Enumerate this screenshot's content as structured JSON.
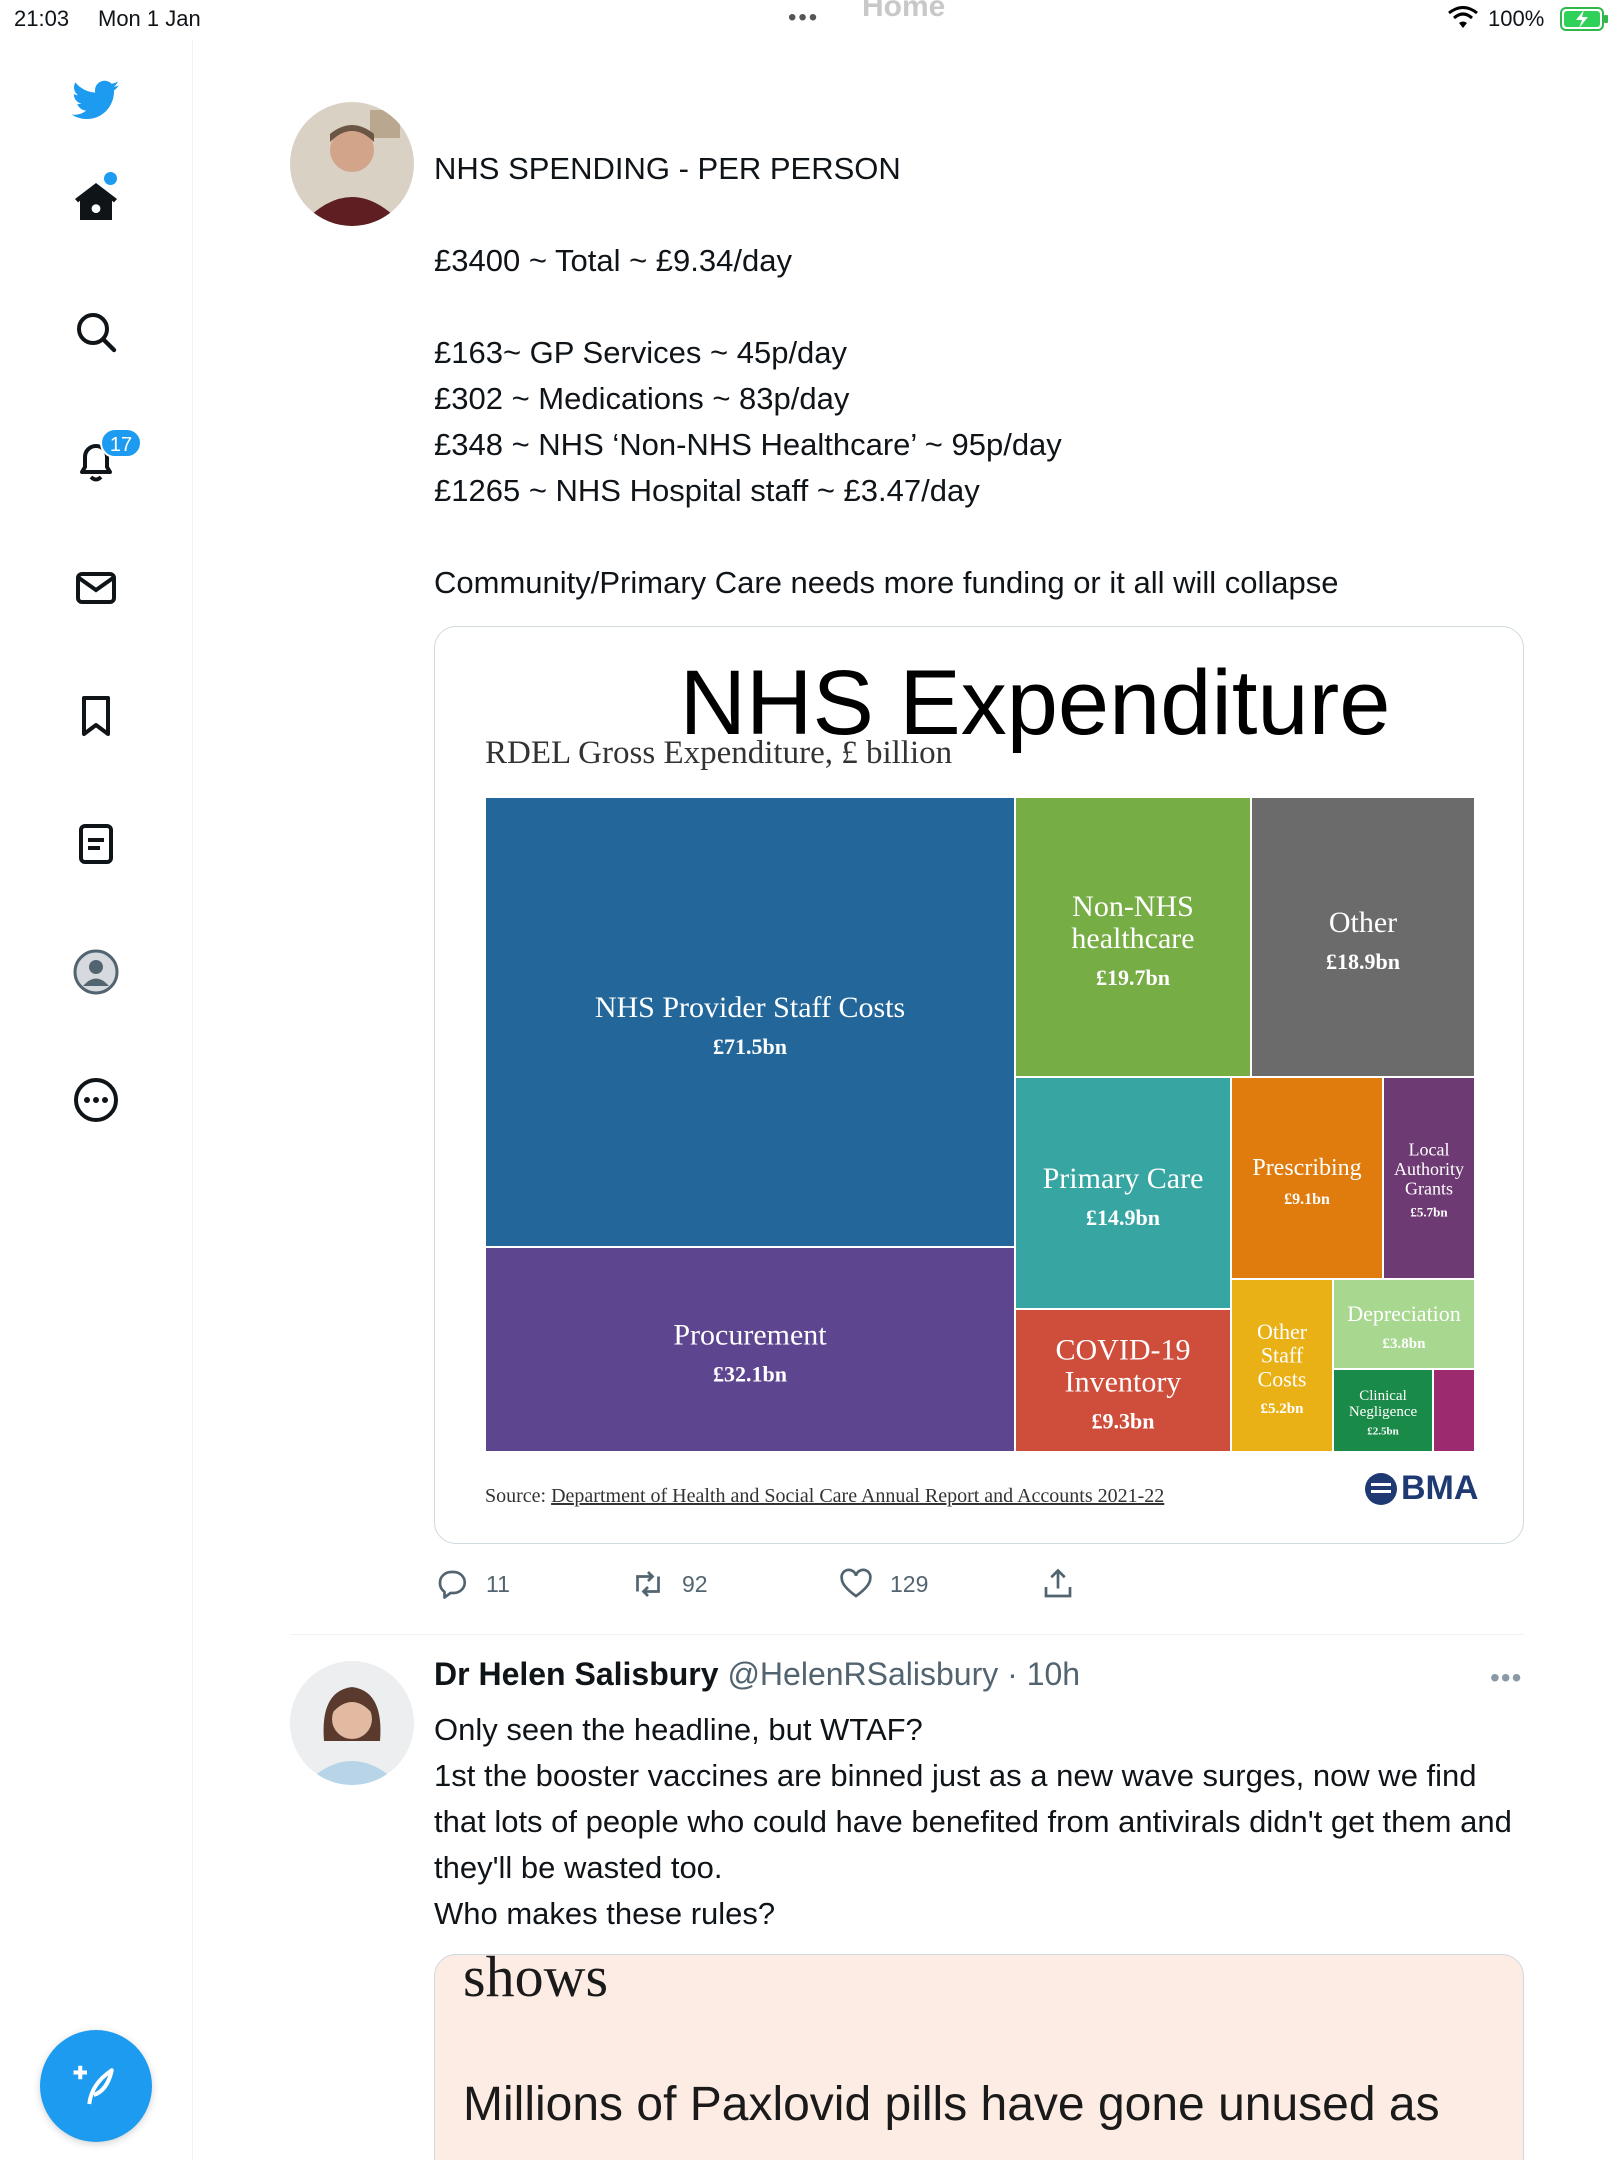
{
  "status_bar": {
    "time": "21:03",
    "date": "Mon 1 Jan",
    "home_label": "Home",
    "battery_percent": "100%"
  },
  "sidebar": {
    "notifications_badge": "17",
    "accent_color": "#1d9bf0",
    "icons": [
      "twitter-bird-icon",
      "home-icon",
      "search-icon",
      "bell-icon",
      "mail-icon",
      "bookmark-icon",
      "lists-icon",
      "profile-icon",
      "more-icon",
      "compose-icon"
    ]
  },
  "tweet1": {
    "text": "NHS SPENDING - PER PERSON\n\n£3400 ~ Total ~ £9.34/day\n\n£163~ GP Services ~ 45p/day\n£302 ~ Medications ~ 83p/day\n£348 ~ NHS ‘Non-NHS Healthcare’ ~ 95p/day\n£1265 ~ NHS Hospital staff ~ £3.47/day\n\nCommunity/Primary Care needs more funding or it all will collapse",
    "replies": "11",
    "retweets": "92",
    "likes": "129"
  },
  "chart_data": {
    "type": "treemap",
    "title": "NHS Expenditure",
    "subtitle": "RDEL Gross Expenditure, £ billion",
    "source_label": "Source:",
    "source_link": "Department of Health and Social Care Annual Report and Accounts 2021-22",
    "logo": "BMA",
    "unit": "£bn",
    "items": [
      {
        "label": "NHS Provider Staff Costs",
        "value_label": "£71.5bn",
        "value": 71.5,
        "color": "#23679a"
      },
      {
        "label": "Procurement",
        "value_label": "£32.1bn",
        "value": 32.1,
        "color": "#5d468f"
      },
      {
        "label": "Non-NHS healthcare",
        "value_label": "£19.7bn",
        "value": 19.7,
        "color": "#77ad45"
      },
      {
        "label": "Other",
        "value_label": "£18.9bn",
        "value": 18.9,
        "color": "#6b6b6b"
      },
      {
        "label": "Primary Care",
        "value_label": "£14.9bn",
        "value": 14.9,
        "color": "#37a6a3"
      },
      {
        "label": "COVID-19 Inventory",
        "value_label": "£9.3bn",
        "value": 9.3,
        "color": "#cf4d3b"
      },
      {
        "label": "Prescribing",
        "value_label": "£9.1bn",
        "value": 9.1,
        "color": "#e07c0e"
      },
      {
        "label": "Local Authority Grants",
        "value_label": "£5.7bn",
        "value": 5.7,
        "color": "#6e3a73"
      },
      {
        "label": "Other Staff Costs",
        "value_label": "£5.2bn",
        "value": 5.2,
        "color": "#e9b115"
      },
      {
        "label": "Depreciation",
        "value_label": "£3.8bn",
        "value": 3.8,
        "color": "#a8d890"
      },
      {
        "label": "Clinical Negligence",
        "value_label": "£2.5bn",
        "value": 2.5,
        "color": "#1a8a48"
      },
      {
        "label": "",
        "value_label": "",
        "value": 2.0,
        "color": "#9b2a6e"
      }
    ]
  },
  "tweet2": {
    "name": "Dr Helen Salisbury",
    "handle": "@HelenRSalisbury",
    "time": "· 10h",
    "text": "Only seen the headline, but WTAF?\n1st the booster vaccines are binned just as a new wave surges, now we find that lots of people who could have benefited from antivirals didn't get them and they'll be wasted too.\nWho makes these rules?",
    "article_top": "shows",
    "article_headline": "Millions of Paxlovid pills have gone unused as"
  }
}
